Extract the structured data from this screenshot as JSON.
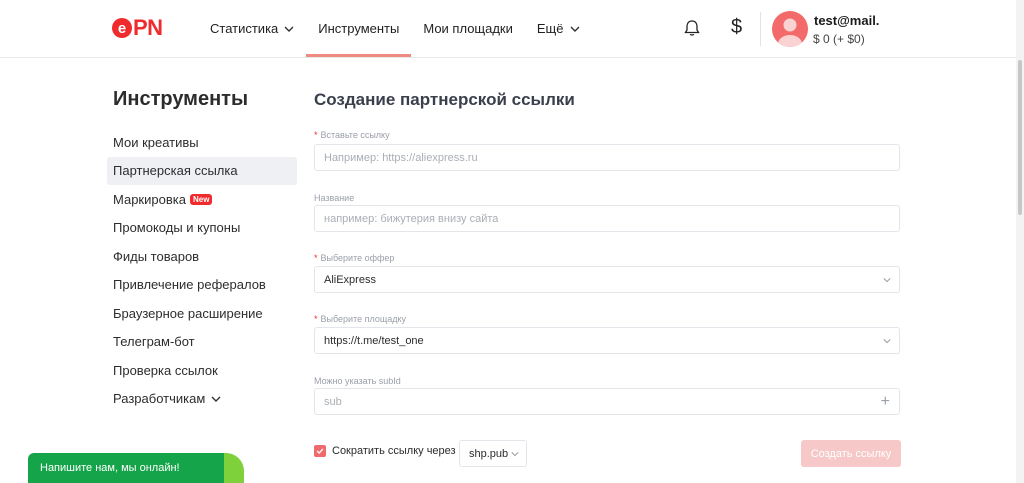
{
  "logo": {
    "text": "PN",
    "mark": "e"
  },
  "nav": [
    {
      "label": "Статистика",
      "dropdown": true
    },
    {
      "label": "Инструменты",
      "active": true
    },
    {
      "label": "Мои площадки"
    },
    {
      "label": "Ещё",
      "dropdown": true
    }
  ],
  "user": {
    "email": "test@mail.",
    "balance": "$ 0 (+ $0)"
  },
  "sidebar": {
    "title": "Инструменты",
    "items": [
      {
        "label": "Мои креативы"
      },
      {
        "label": "Партнерская ссылка",
        "selected": true
      },
      {
        "label": "Маркировка",
        "badge": "New"
      },
      {
        "label": "Промокоды и купоны"
      },
      {
        "label": "Фиды товаров"
      },
      {
        "label": "Привлечение рефералов"
      },
      {
        "label": "Браузерное расширение"
      },
      {
        "label": "Телеграм-бот"
      },
      {
        "label": "Проверка ссылок"
      },
      {
        "label": "Разработчикам",
        "dropdown": true
      }
    ]
  },
  "form": {
    "title": "Создание партнерской ссылки",
    "link": {
      "label": "Вставьте ссылку",
      "required": true,
      "placeholder": "Например: https://aliexpress.ru"
    },
    "name": {
      "label": "Название",
      "placeholder": "например: бижутерия внизу сайта"
    },
    "offer": {
      "label": "Выберите оффер",
      "required": true,
      "value": "AliExpress"
    },
    "platform": {
      "label": "Выберите площадку",
      "required": true,
      "value": "https://t.me/test_one"
    },
    "subid": {
      "label": "Можно указать subId",
      "placeholder": "sub"
    },
    "shorten": {
      "label": "Сократить ссылку через",
      "checked": true,
      "service": "shp.pub"
    },
    "submit_label": "Создать ссылку"
  },
  "chat": {
    "label": "Напишите нам, мы онлайн!"
  },
  "colors": {
    "brand": "#ef2b2d",
    "accent_underline": "#ef8a80",
    "chat_green": "#16a44a",
    "button_disabled": "#f6c8c8"
  }
}
